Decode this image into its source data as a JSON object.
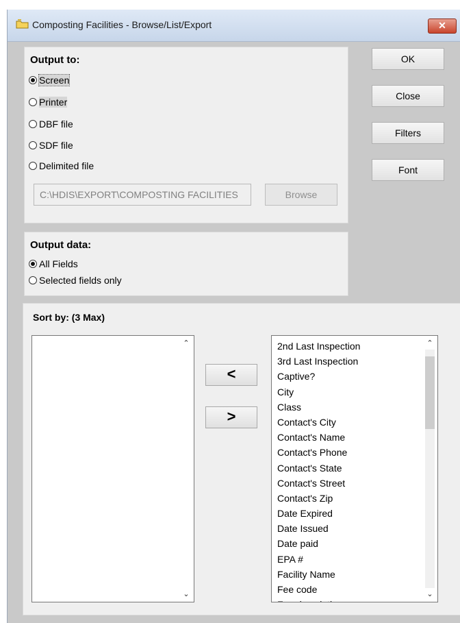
{
  "window": {
    "title": "Composting Facilities - Browse/List/Export",
    "close_label": "✕"
  },
  "output_to": {
    "heading": "Output to:",
    "options": [
      "Screen",
      "Printer",
      "DBF file",
      "SDF file",
      "Delimited file"
    ],
    "selected": "Screen",
    "path_value": "C:\\HDIS\\EXPORT\\COMPOSTING FACILITIES",
    "browse_label": "Browse"
  },
  "buttons": {
    "ok": "OK",
    "close": "Close",
    "filters": "Filters",
    "font": "Font"
  },
  "output_data": {
    "heading": "Output data:",
    "options": [
      "All Fields",
      "Selected fields only"
    ],
    "selected": "All Fields"
  },
  "sort_by": {
    "heading": "Sort by: (3 Max)",
    "move_left_label": "<",
    "move_right_label": ">",
    "selected_fields": [],
    "available_fields": [
      "2nd Last Inspection",
      "3rd Last Inspection",
      "Captive?",
      "City",
      "Class",
      "Contact's City",
      "Contact's Name",
      "Contact's Phone",
      "Contact's State",
      "Contact's Street",
      "Contact's Zip",
      "Date Expired",
      "Date Issued",
      "Date paid",
      "EPA #",
      "Facility Name",
      "Fee code",
      "Fee description"
    ]
  },
  "scroll": {
    "up": "⌃",
    "down": "⌄"
  },
  "colors": {
    "window_bg": "#c9c9c9",
    "panel_bg": "#efefef",
    "close_btn": "#c9452d"
  }
}
